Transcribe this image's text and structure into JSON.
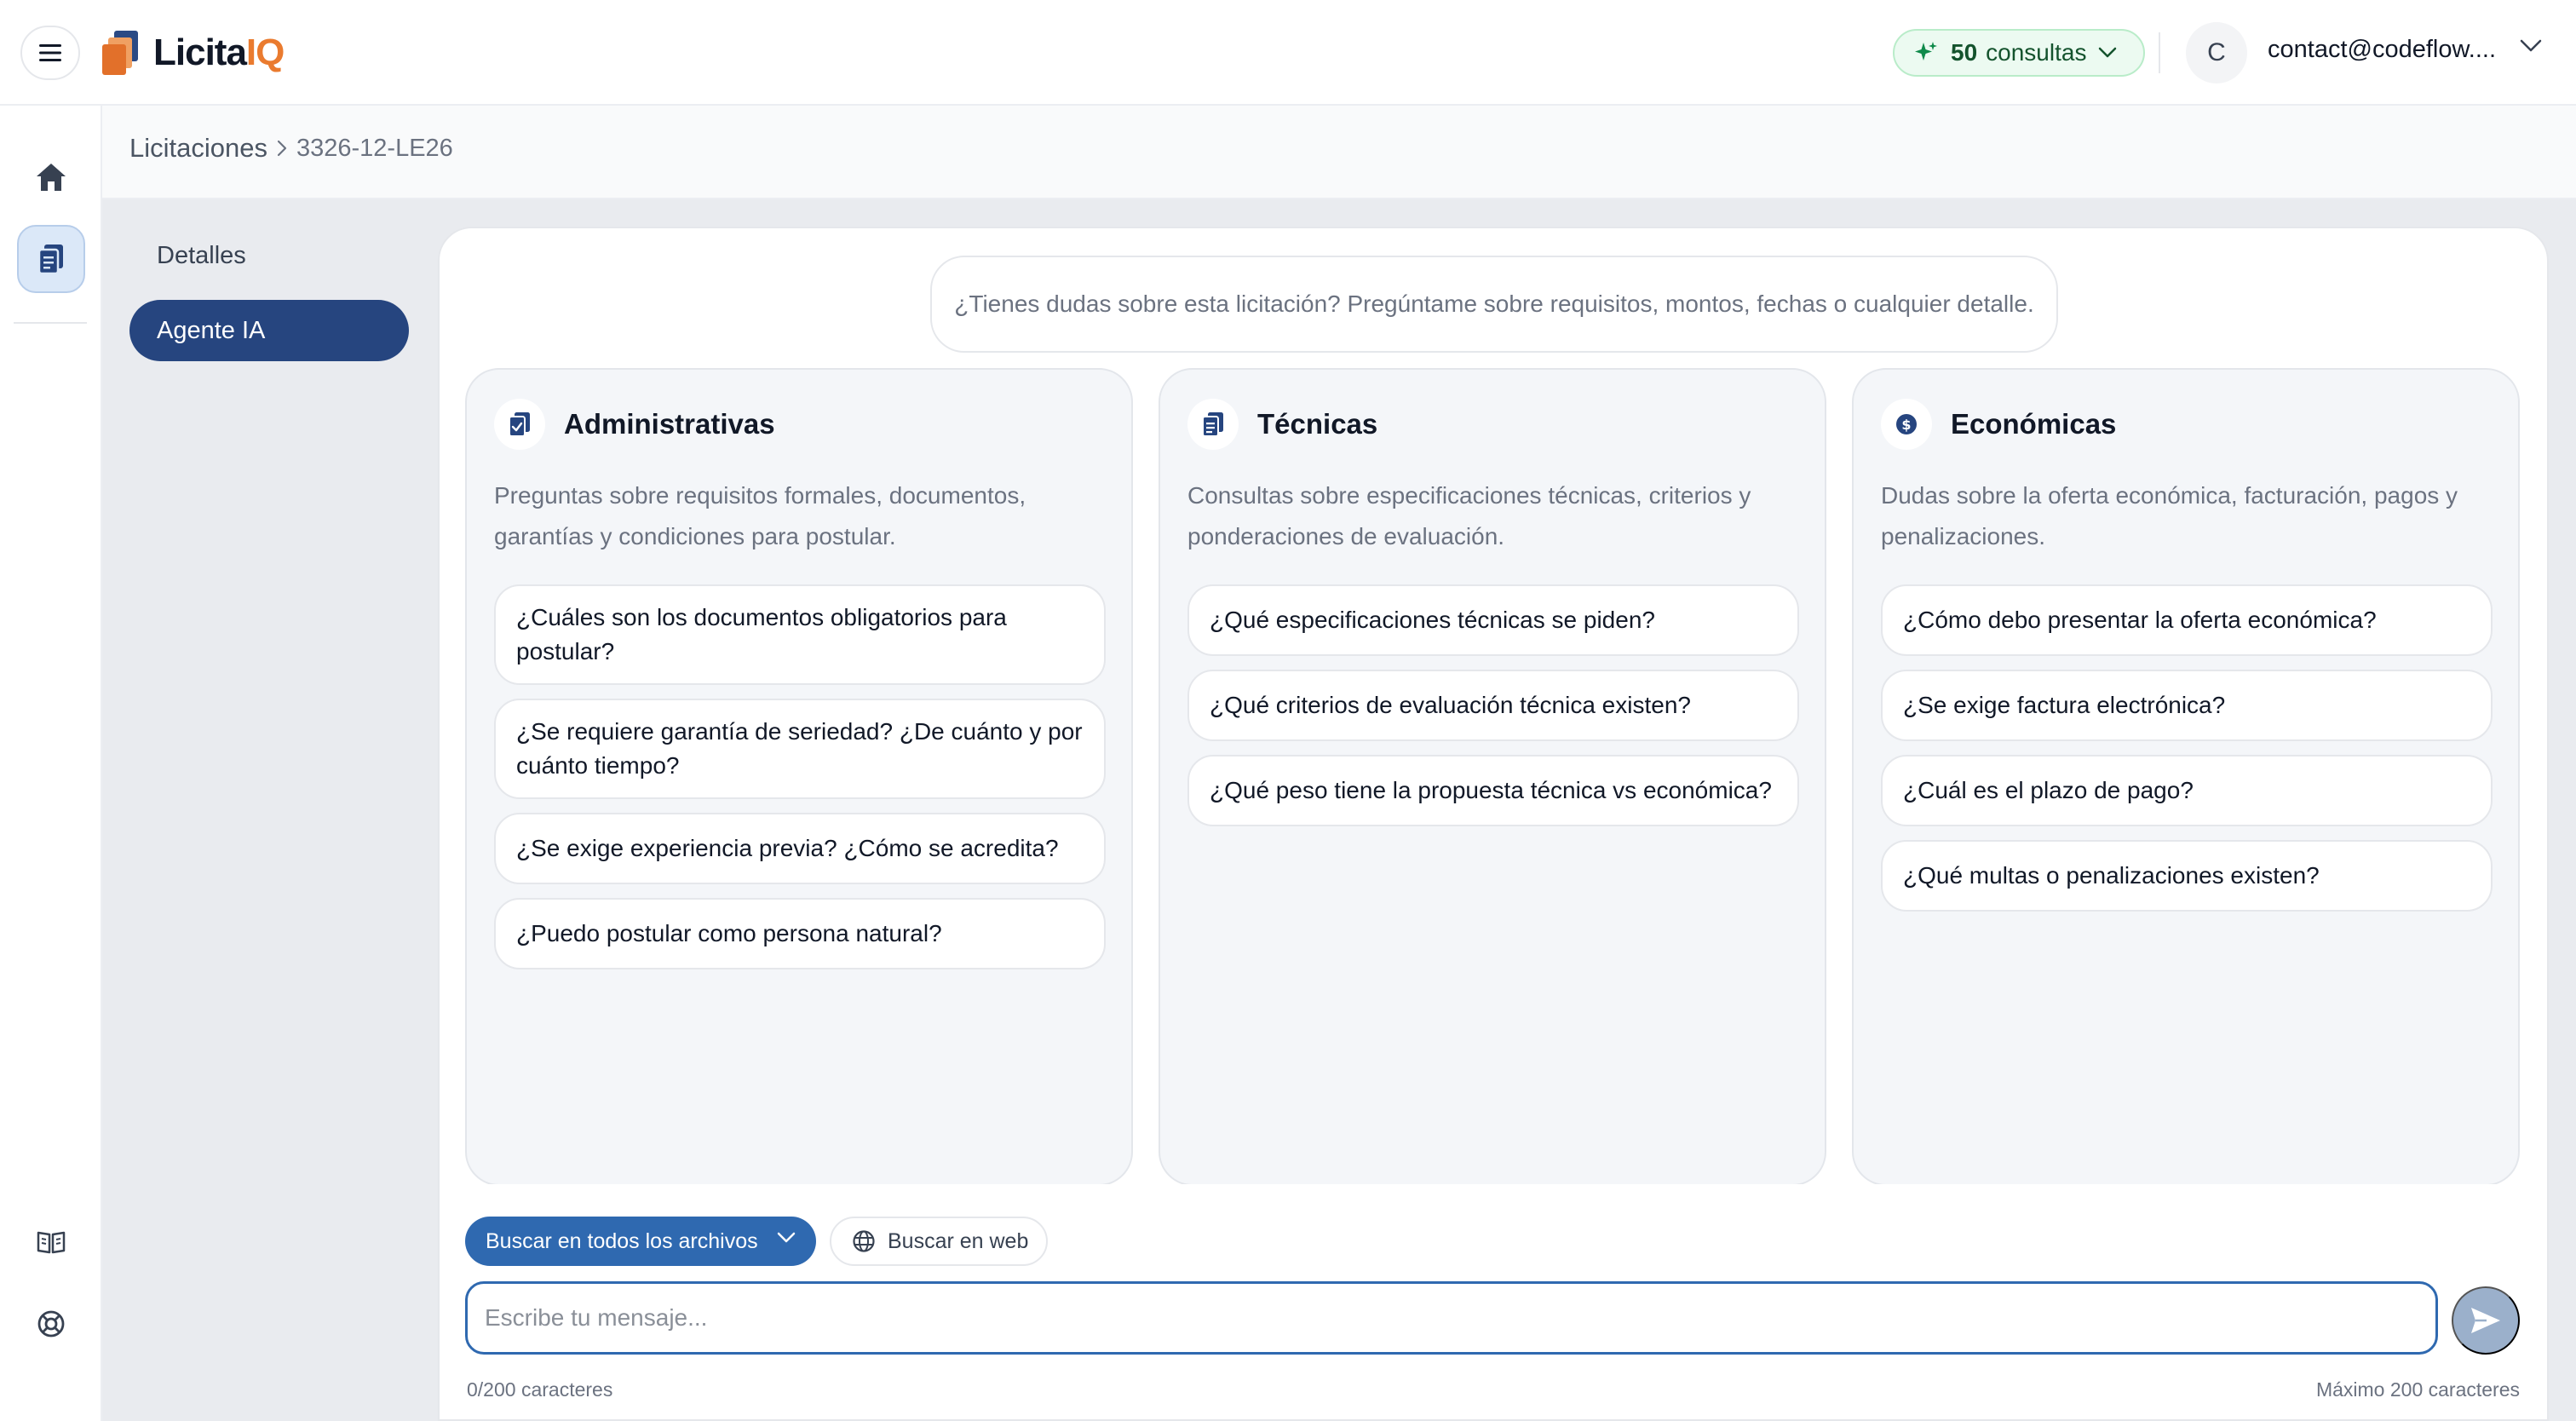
{
  "header": {
    "logo_main": "Licita",
    "logo_accent": "IQ",
    "credits_count": "50",
    "credits_label": "consultas",
    "avatar_initial": "C",
    "user_email": "contact@codeflow...."
  },
  "breadcrumb": {
    "root": "Licitaciones",
    "current": "3326-12-LE26"
  },
  "subnav": {
    "items": [
      {
        "label": "Detalles",
        "active": false
      },
      {
        "label": "Agente IA",
        "active": true
      }
    ]
  },
  "chat": {
    "intro": "¿Tienes dudas sobre esta licitación? Pregúntame sobre requisitos, montos, fechas o cualquier detalle.",
    "categories": [
      {
        "title": "Administrativas",
        "icon": "clipboard-check-icon",
        "description": "Preguntas sobre requisitos formales, documentos, garantías y condiciones para postular.",
        "questions": [
          "¿Cuáles son los documentos obligatorios para postular?",
          "¿Se requiere garantía de seriedad? ¿De cuánto y por cuánto tiempo?",
          "¿Se exige experiencia previa? ¿Cómo se acredita?",
          "¿Puedo postular como persona natural?"
        ]
      },
      {
        "title": "Técnicas",
        "icon": "clipboard-list-icon",
        "description": "Consultas sobre especificaciones técnicas, criterios y ponderaciones de evaluación.",
        "questions": [
          "¿Qué especificaciones técnicas se piden?",
          "¿Qué criterios de evaluación técnica existen?",
          "¿Qué peso tiene la propuesta técnica vs económica?"
        ]
      },
      {
        "title": "Económicas",
        "icon": "dollar-coin-icon",
        "description": "Dudas sobre la oferta económica, facturación, pagos y penalizaciones.",
        "questions": [
          "¿Cómo debo presentar la oferta económica?",
          "¿Se exige factura electrónica?",
          "¿Cuál es el plazo de pago?",
          "¿Qué multas o penalizaciones existen?"
        ]
      }
    ]
  },
  "composer": {
    "scope_label": "Buscar en todos los archivos",
    "web_label": "Buscar en web",
    "placeholder": "Escribe tu mensaje...",
    "value": "",
    "counter": "0/200 caracteres",
    "max_label": "Máximo 200 caracteres"
  },
  "colors": {
    "accent": "#26457f",
    "primary_button": "#2f69b0",
    "logo_orange": "#ea7b2f",
    "credits_green": "#ecfaf1"
  }
}
